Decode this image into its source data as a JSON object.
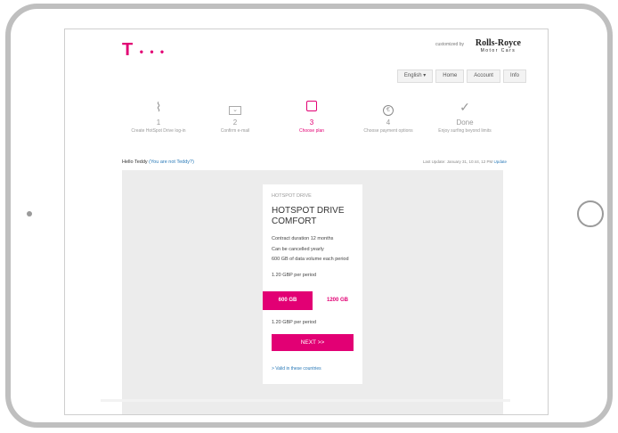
{
  "brand": {
    "logo": "T",
    "logo_dots": "• • •",
    "accent": "#e20074"
  },
  "partner": {
    "customized_by": "customized by",
    "name": "Rolls-Royce",
    "sub": "Motor Cars"
  },
  "nav": {
    "language": "English ▾",
    "home": "Home",
    "account": "Account",
    "info": "Info"
  },
  "steps": [
    {
      "num": "1",
      "label": "Create HotSpot Drive log-in",
      "icon": "hotspot-tag-icon"
    },
    {
      "num": "2",
      "label": "Confirm e-mail",
      "icon": "envelope-icon"
    },
    {
      "num": "3",
      "label": "Choose plan",
      "icon": "package-icon"
    },
    {
      "num": "4",
      "label": "Choose payment options",
      "icon": "euro-icon"
    },
    {
      "num": "Done",
      "label": "Enjoy surfing beyond limits",
      "icon": "check-icon"
    }
  ],
  "greeting": {
    "text": "Hello Teddy ",
    "not_you": "(You are not Teddy?)"
  },
  "update": {
    "text": "Last Update: January 31, 10:44, 12 PM ",
    "link": "Update"
  },
  "plan": {
    "kicker": "HOTSPOT DRIVE",
    "title": "HOTSPOT DRIVE COMFORT",
    "features": [
      "Contract duration 12 months",
      "Can be cancelled yearly",
      "600 GB of data volume each period",
      "1.20 GBP per period"
    ],
    "options": [
      "600 GB",
      "1200 GB"
    ],
    "price": "1.20 GBP per period",
    "next": "NEXT >>",
    "valid": "> Valid in these countries"
  }
}
